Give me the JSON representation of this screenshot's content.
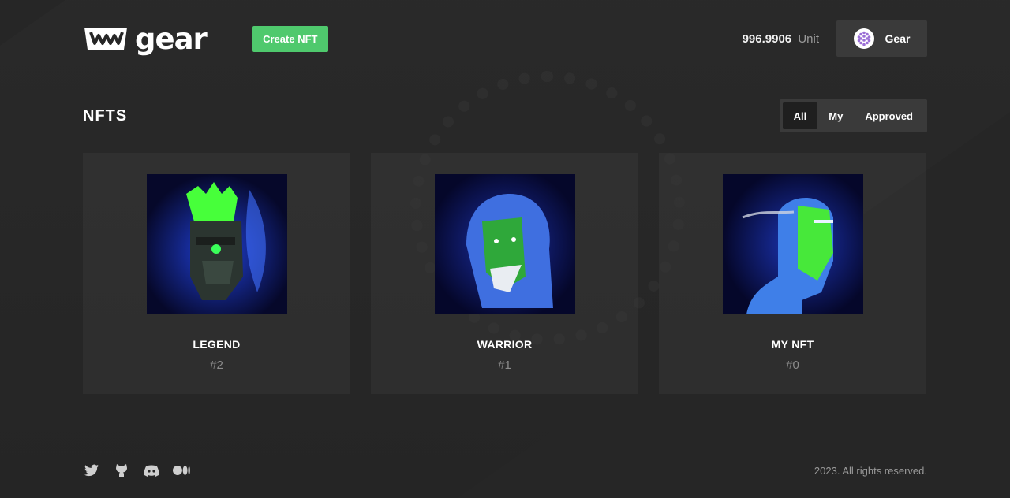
{
  "brand": {
    "name": "gear"
  },
  "header": {
    "create_label": "Create NFT",
    "balance_value": "996.9906",
    "balance_unit": "Unit",
    "account_name": "Gear"
  },
  "page": {
    "title": "NFTS"
  },
  "filters": [
    {
      "label": "All",
      "active": true
    },
    {
      "label": "My",
      "active": false
    },
    {
      "label": "Approved",
      "active": false
    }
  ],
  "nfts": [
    {
      "name": "LEGEND",
      "id": "#2",
      "art": "legionnaire-icon"
    },
    {
      "name": "WARRIOR",
      "id": "#1",
      "art": "hooded-warrior-icon"
    },
    {
      "name": "MY NFT",
      "id": "#0",
      "art": "hero-icon"
    }
  ],
  "footer": {
    "socials": [
      "twitter-icon",
      "github-icon",
      "discord-icon",
      "medium-icon"
    ],
    "copyright": "2023. All rights reserved."
  },
  "colors": {
    "accent": "#4fc96d",
    "background": "#262626",
    "card": "#333333"
  }
}
